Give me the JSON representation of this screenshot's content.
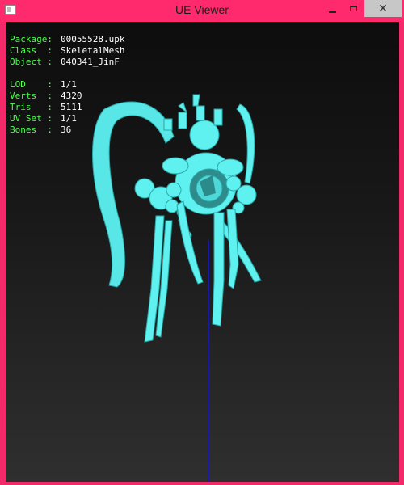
{
  "window": {
    "title": "UE Viewer",
    "accent": "#ff2a6d",
    "controls": {
      "minimize": "minimize-icon",
      "maximize": "maximize-icon",
      "close": "close-icon"
    }
  },
  "info": {
    "object": [
      {
        "label": "Package",
        "value": "00055528.upk"
      },
      {
        "label": "Class",
        "value": "SkeletalMesh"
      },
      {
        "label": "Object",
        "value": "040341_JinF"
      }
    ],
    "stats": [
      {
        "label": "LOD",
        "value": "1/1"
      },
      {
        "label": "Verts",
        "value": "4320"
      },
      {
        "label": "Tris",
        "value": "5111"
      },
      {
        "label": "UV Set",
        "value": "1/1"
      },
      {
        "label": "Bones",
        "value": "36"
      }
    ]
  },
  "mesh_color": "#5ff0f0"
}
